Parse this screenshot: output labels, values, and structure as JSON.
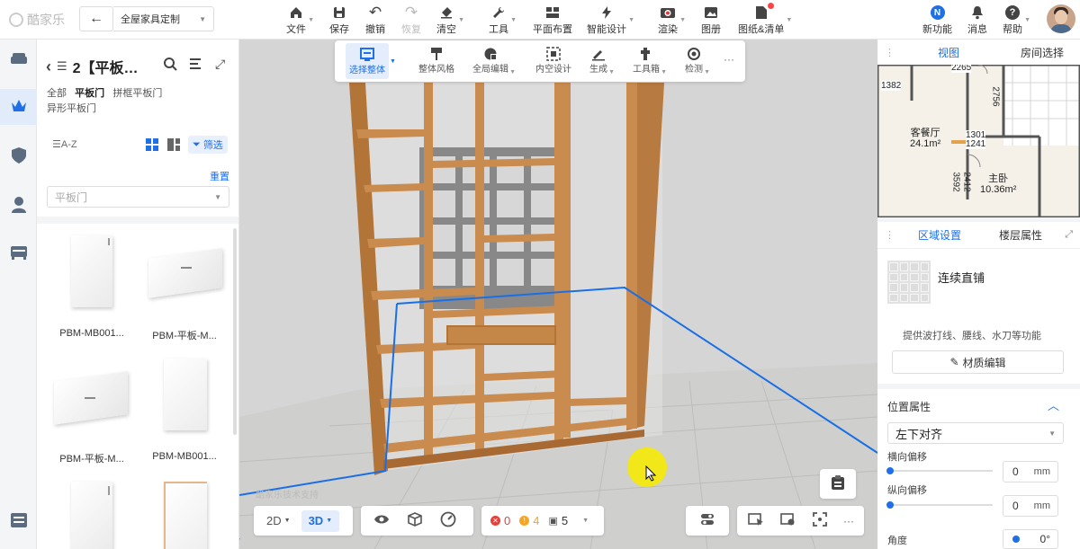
{
  "app": {
    "logo_text": "酷家乐",
    "module": "全屋家具定制"
  },
  "toolbar": {
    "items": [
      {
        "label": "文件",
        "icon": "home-icon"
      },
      {
        "label": "保存",
        "icon": "save-icon"
      },
      {
        "label": "撤销",
        "icon": "undo-icon"
      },
      {
        "label": "恢复",
        "icon": "redo-icon"
      },
      {
        "label": "清空",
        "icon": "eraser-icon"
      },
      {
        "label": "工具",
        "icon": "wrench-icon"
      },
      {
        "label": "平面布置",
        "icon": "layout-icon"
      },
      {
        "label": "智能设计",
        "icon": "lightning-icon"
      },
      {
        "label": "渲染",
        "icon": "camera-icon"
      },
      {
        "label": "图册",
        "icon": "image-icon"
      },
      {
        "label": "图纸&清单",
        "icon": "document-icon"
      }
    ],
    "right": [
      {
        "label": "新功能",
        "icon": "new-feature-icon"
      },
      {
        "label": "消息",
        "icon": "bell-icon"
      },
      {
        "label": "帮助",
        "icon": "help-icon"
      }
    ]
  },
  "left_panel": {
    "title": "2【平板…",
    "categories": [
      "全部",
      "平板门",
      "拼框平板门",
      "异形平板门"
    ],
    "sort_label": "A-Z",
    "filter_label": "筛选",
    "reset_label": "重置",
    "select_placeholder": "平板门",
    "products": [
      {
        "label": "PBM-MB001..."
      },
      {
        "label": "PBM-平板-M..."
      },
      {
        "label": "PBM-平板-M..."
      },
      {
        "label": "PBM-MB001..."
      },
      {
        "label": ""
      },
      {
        "label": ""
      }
    ]
  },
  "float_toolbar": {
    "items": [
      {
        "label": "选择整体",
        "icon": "select-all-icon"
      },
      {
        "label": "整体风格",
        "icon": "style-icon"
      },
      {
        "label": "全局编辑",
        "icon": "global-edit-icon"
      },
      {
        "label": "内空设计",
        "icon": "inner-space-icon"
      },
      {
        "label": "生成",
        "icon": "generate-icon"
      },
      {
        "label": "工具箱",
        "icon": "toolbox-icon"
      },
      {
        "label": "检测",
        "icon": "detect-icon"
      }
    ],
    "more": "···"
  },
  "bottom_bar": {
    "mode_2d": "2D",
    "mode_3d": "3D",
    "errors": "0",
    "warnings": "4",
    "items": "5",
    "more": "···"
  },
  "watermark": "酷家乐技术支持",
  "right_panel": {
    "tabs": [
      "视图",
      "房间选择"
    ],
    "floorplan": {
      "rooms": [
        {
          "name": "客餐厅",
          "area": "24.1m²"
        },
        {
          "name": "主卧",
          "area": "10.36m²"
        }
      ],
      "dims": [
        "2265",
        "1382",
        "2756",
        "1301",
        "1241",
        "3592",
        "2412"
      ]
    },
    "panel_tabs": [
      "区域设置",
      "楼层属性"
    ],
    "paving_mode": "连续直铺",
    "paving_desc": "提供波打线、腰线、水刀等功能",
    "material_btn": "材质编辑",
    "position_title": "位置属性",
    "align_value": "左下对齐",
    "h_offset_label": "横向偏移",
    "h_offset_value": "0",
    "v_offset_label": "纵向偏移",
    "v_offset_value": "0",
    "unit": "mm",
    "angle_label": "角度",
    "angle_value": "0°"
  },
  "colors": {
    "accent": "#1e6fe8",
    "wood": "#c98b4e",
    "selection": "#1a6fe6"
  }
}
